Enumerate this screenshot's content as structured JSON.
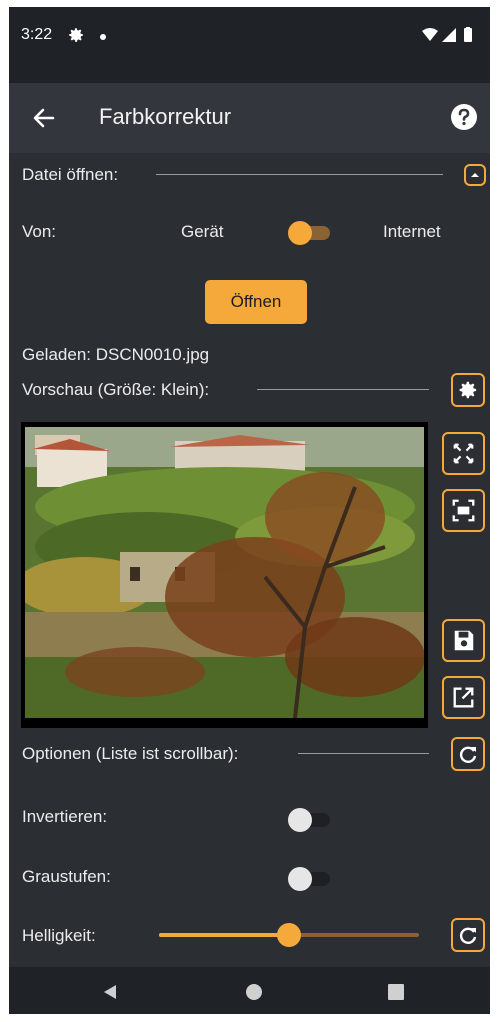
{
  "status_bar": {
    "time": "3:22"
  },
  "app_bar": {
    "title": "Farbkorrektur"
  },
  "file_section": {
    "header": "Datei öffnen:",
    "source_label": "Von:",
    "source_left": "Gerät",
    "source_right": "Internet",
    "source_is_internet": false,
    "open_button": "Öffnen",
    "loaded_text": "Geladen: DSCN0010.jpg"
  },
  "preview_section": {
    "header": "Vorschau (Größe: Klein):"
  },
  "options_section": {
    "header": "Optionen (Liste ist scrollbar):",
    "invert_label": "Invertieren:",
    "invert_on": false,
    "grayscale_label": "Graustufen:",
    "grayscale_on": false,
    "brightness_label": "Helligkeit:",
    "brightness_value_fraction": 0.5
  },
  "colors": {
    "accent": "#f6a93b",
    "background": "#2b2e33",
    "app_bar": "#33363c",
    "status_bar": "#1f2226"
  },
  "icons": {
    "header": [
      "back-arrow-icon",
      "help-icon"
    ],
    "file": [
      "collapse-icon"
    ],
    "preview": [
      "settings-icon",
      "fullscreen-icon",
      "fit-icon",
      "save-icon",
      "open-external-icon"
    ],
    "options": [
      "reset-icon"
    ]
  }
}
